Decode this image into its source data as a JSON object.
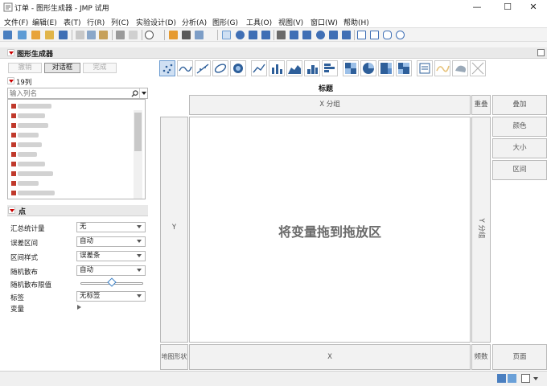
{
  "window": {
    "title": "订单 - 图形生成器 - JMP 试用",
    "min_glyph": "—",
    "max_glyph": "☐",
    "close_glyph": "✕"
  },
  "menus": [
    "文件(F)",
    "编辑(E)",
    "表(T)",
    "行(R)",
    "列(C)",
    "实验设计(D)",
    "分析(A)",
    "图形(G)",
    "工具(O)",
    "视图(V)",
    "窗口(W)",
    "帮助(H)"
  ],
  "panel": {
    "title": "图形生成器"
  },
  "buttons": {
    "undo": "撤销",
    "dialog": "对话框",
    "done": "完成"
  },
  "columns": {
    "count_label": "19列",
    "search_placeholder": "输入列名"
  },
  "points": {
    "title": "点",
    "labels": {
      "summary_stat": "汇总统计量",
      "error_interval": "误差区间",
      "interval_style": "区间样式",
      "jitter": "随机散布",
      "jitter_limit": "随机散布限值",
      "label": "标签",
      "variables": "变量"
    },
    "values": {
      "summary_stat": "无",
      "error_interval": "自动",
      "interval_style": "误差条",
      "jitter": "自动",
      "label": "无标签"
    },
    "jitter_limit_fraction": 0.5
  },
  "graph": {
    "title": "标题",
    "x_group": "X 分组",
    "overlay": "重叠",
    "y": "Y",
    "y_group": "Y 分组",
    "drop_hint": "将变量拖到拖放区",
    "map_shape": "地图形状",
    "x": "X",
    "freq": "频数",
    "page": "页面"
  },
  "roles": [
    "叠加",
    "颜色",
    "大小",
    "区间"
  ]
}
